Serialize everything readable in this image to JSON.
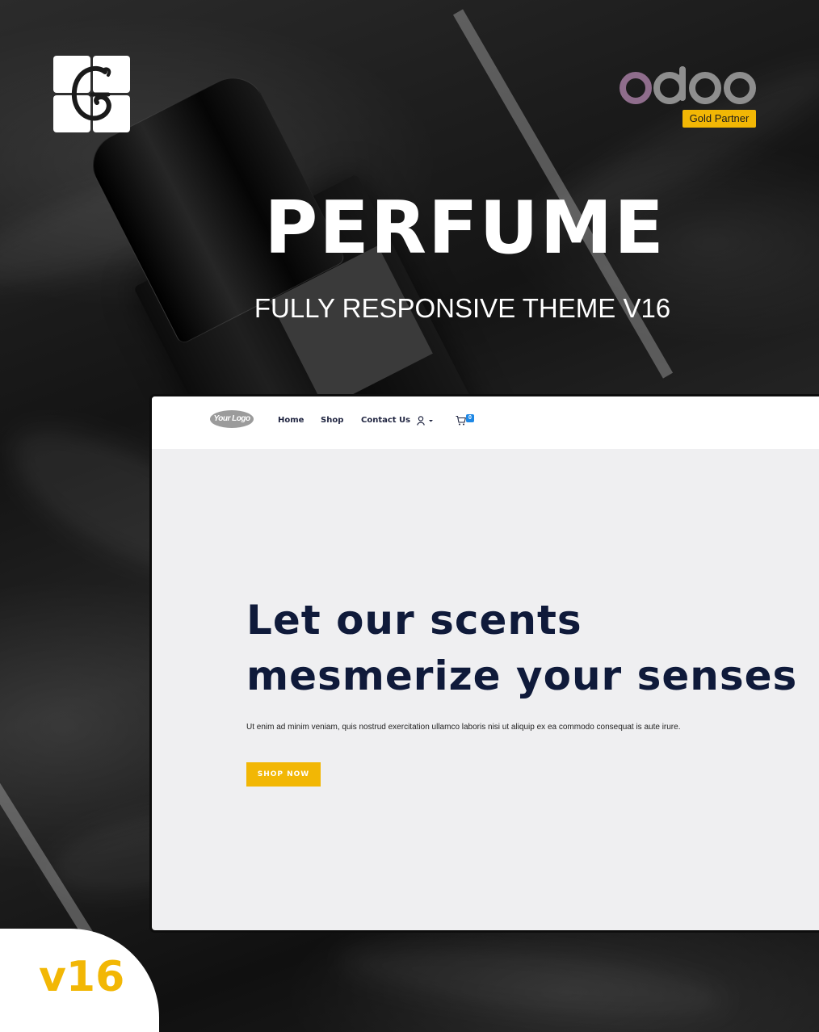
{
  "banner": {
    "title": "PERFUME",
    "subtitle": "FULLY RESPONSIVE THEME V16",
    "partner_badge": "Gold Partner",
    "version_badge": "v16",
    "accent_color": "#f2b705",
    "odoo_logo_text": "odoo",
    "brand_logo_icon": "cg-monogram-icon"
  },
  "mock_site": {
    "logo_text": "Your Logo",
    "nav": {
      "home": "Home",
      "shop": "Shop",
      "contact": "Contact Us"
    },
    "cart_count": "0",
    "hero": {
      "heading": "Let our scents mesmerize your senses",
      "text": "Ut enim ad minim veniam, quis nostrud exercitation ullamco laboris nisi ut aliquip ex ea commodo consequat is aute irure.",
      "button": "SHOP NOW"
    },
    "heading_color": "#0f1a3a",
    "page_bg": "#efeff1"
  }
}
